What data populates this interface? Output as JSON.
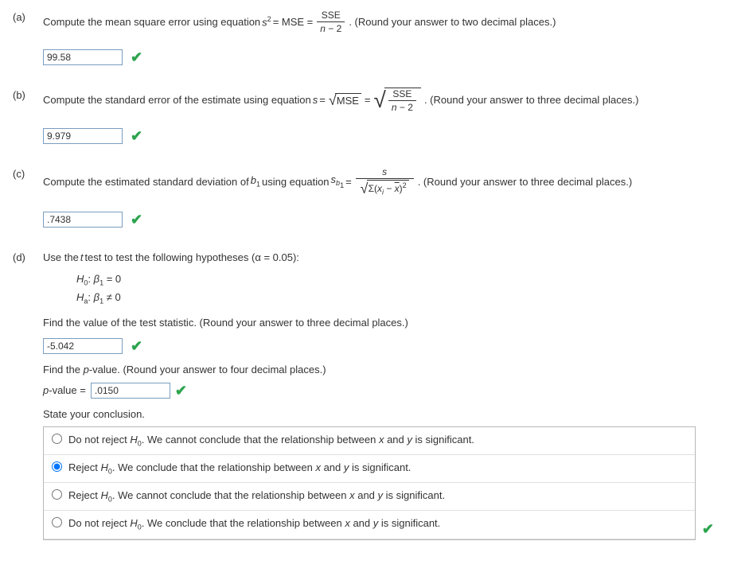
{
  "a": {
    "label": "(a)",
    "prompt_pre": "Compute the mean square error using equation ",
    "eq_lhs": "s",
    "eq_mid": " = MSE = ",
    "frac_num": "SSE",
    "frac_den_left": "n",
    "frac_den_right": " − 2",
    "prompt_post": ". (Round your answer to two decimal places.)",
    "value": "99.58"
  },
  "b": {
    "label": "(b)",
    "prompt_pre": "Compute the standard error of the estimate using equation ",
    "eq_s": "s",
    "eq_eq1": " = ",
    "sqrt_mse": "MSE",
    "eq_eq2": " = ",
    "frac_num": "SSE",
    "frac_den_left": "n",
    "frac_den_right": " − 2",
    "prompt_post": ". (Round your answer to three decimal places.)",
    "value": "9.979"
  },
  "c": {
    "label": "(c)",
    "prompt_pre": "Compute the estimated standard deviation of ",
    "b1": "b",
    "b1_sub": "1",
    "prompt_mid": " using equation ",
    "sb": "s",
    "sb_sub_b": "b",
    "sb_sub_1": "1",
    "eq": " = ",
    "frac_num": "s",
    "den_sigma": "Σ(",
    "den_xi": "x",
    "den_i": "i",
    "den_minus": " − ",
    "den_xbar": "x",
    "den_close": ")",
    "den_sq": "2",
    "prompt_post": ". (Round your answer to three decimal places.)",
    "value": ".7438"
  },
  "d": {
    "label": "(d)",
    "prompt_main": "Use the ",
    "t": "t",
    "prompt_main2": " test to test the following hypotheses (α = 0.05):",
    "h0_label": "H",
    "h0_sub": "0",
    "h0_colon": ": ",
    "beta": "β",
    "beta_sub": "1",
    "h0_eq": " = 0",
    "ha_label": "H",
    "ha_sub": "a",
    "ha_colon": ": ",
    "ha_eq": " ≠ 0",
    "find_stat": "Find the value of the test statistic. (Round your answer to three decimal places.)",
    "stat_value": "-5.042",
    "find_pval": "Find the ",
    "pword": "p",
    "find_pval2": "-value. (Round your answer to four decimal places.)",
    "pval_label_pre": "p",
    "pval_label_post": "-value = ",
    "pval_value": ".0150",
    "conclusion_prompt": "State your conclusion.",
    "options": {
      "o1_pre": "Do not reject ",
      "o1_post": ". We cannot conclude that the relationship between ",
      "o1_end": " is significant.",
      "o2_pre": "Reject ",
      "o2_post": ". We conclude that the relationship between ",
      "o2_end": " is significant.",
      "o3_pre": "Reject ",
      "o3_post": ". We cannot conclude that the relationship between ",
      "o3_end": " is significant.",
      "o4_pre": "Do not reject ",
      "o4_post": ". We conclude that the relationship between ",
      "o4_end": " is significant.",
      "x": "x",
      "and": " and ",
      "y": "y",
      "H": "H",
      "zero": "0"
    }
  }
}
